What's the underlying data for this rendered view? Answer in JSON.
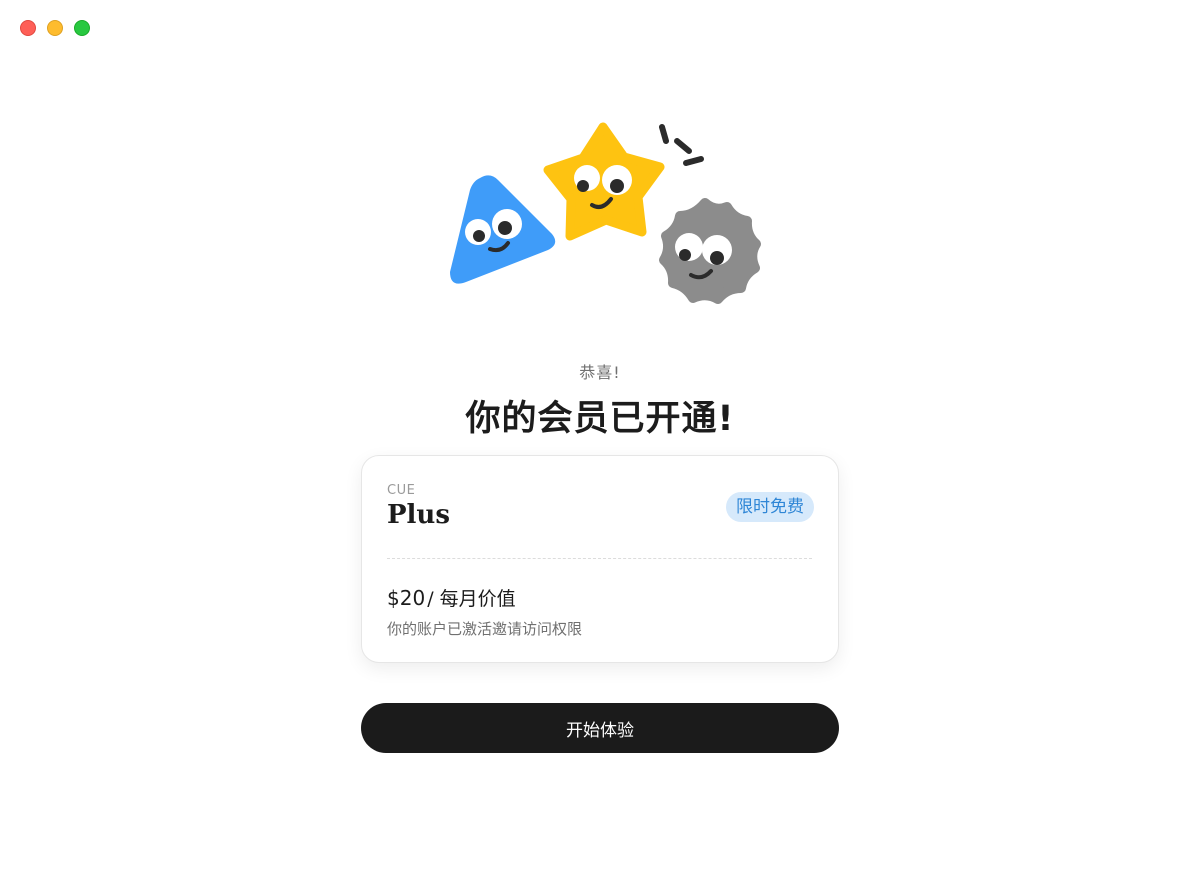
{
  "window": {
    "controls": [
      "close",
      "minimize",
      "maximize"
    ]
  },
  "illustration": {
    "characters": [
      {
        "shape": "triangle",
        "color": "#3f9cf9"
      },
      {
        "shape": "star",
        "color": "#fec311"
      },
      {
        "shape": "badge",
        "color": "#8c8c8c"
      }
    ],
    "accent_color": "#2b2b2b"
  },
  "header": {
    "subtitle": "恭喜!",
    "title": "你的会员已开通!"
  },
  "plan_card": {
    "brand": "CUE",
    "plan_name": "Plus",
    "badge": "限时免费",
    "price": "$20",
    "period": "/ 每月价值",
    "description": "你的账户已激活邀请访问权限"
  },
  "actions": {
    "start_label": "开始体验"
  },
  "colors": {
    "badge_bg": "#d6e9fb",
    "badge_text": "#2f86d6",
    "button_bg": "#1b1b1b"
  }
}
